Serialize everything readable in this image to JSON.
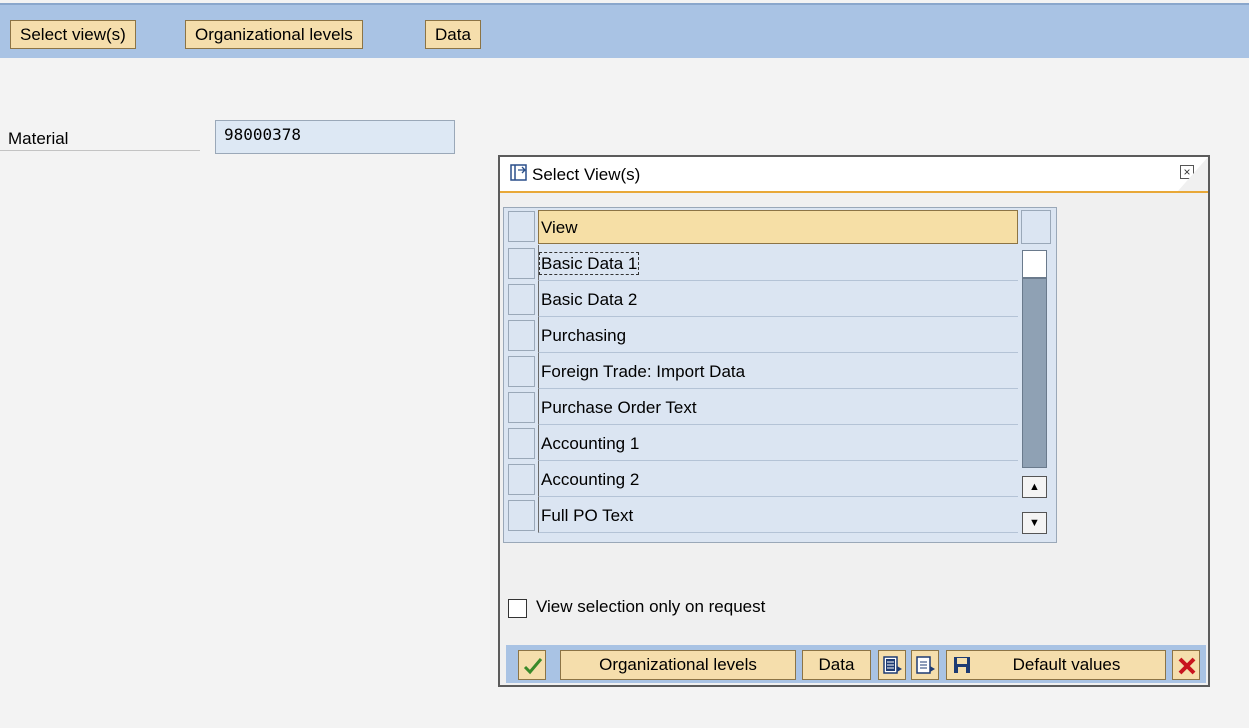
{
  "toolbar": {
    "buttons": [
      {
        "label": "Select view(s)"
      },
      {
        "label": "Organizational levels"
      },
      {
        "label": "Data"
      }
    ]
  },
  "material": {
    "label": "Material",
    "value": "98000378"
  },
  "dialog": {
    "title": "Select View(s)",
    "table": {
      "header": "View",
      "rows": [
        {
          "label": "Basic Data 1",
          "focused": true
        },
        {
          "label": "Basic Data 2"
        },
        {
          "label": "Purchasing"
        },
        {
          "label": "Foreign Trade: Import Data"
        },
        {
          "label": "Purchase Order Text"
        },
        {
          "label": "Accounting 1"
        },
        {
          "label": "Accounting 2"
        },
        {
          "label": "Full PO Text"
        }
      ]
    },
    "checkbox": {
      "label": "View selection only on request",
      "checked": false
    },
    "footer": {
      "org_levels_label": "Organizational levels",
      "data_label": "Data",
      "default_values_label": "Default values"
    }
  },
  "icons": {
    "confirm": "check-icon",
    "select_all": "select-all-icon",
    "deselect_all": "deselect-all-icon",
    "save": "save-icon",
    "cancel": "cancel-icon"
  }
}
